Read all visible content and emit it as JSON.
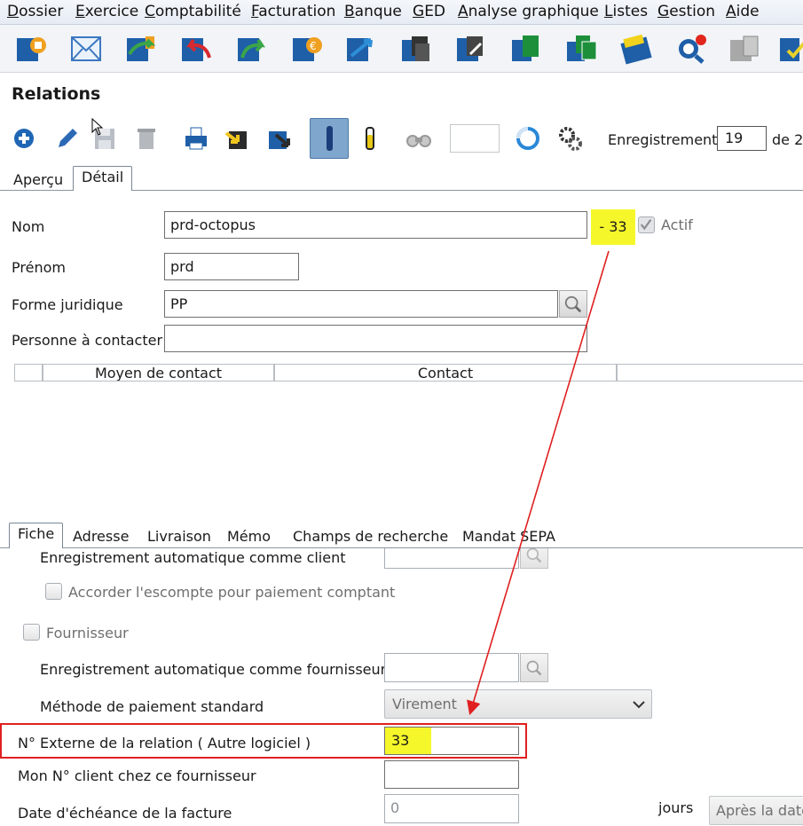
{
  "menu": [
    "Dossier",
    "Exercice",
    "Comptabilité",
    "Facturation",
    "Banque",
    "GED",
    "Analyse graphique",
    "Listes",
    "Gestion",
    "Aide"
  ],
  "toolbar_icons": [
    "dossier-icon",
    "mail-icon",
    "import-icon",
    "undo-icon",
    "redo-icon",
    "euro-icon",
    "transfer-icon",
    "copy-icon",
    "attach-icon",
    "document-green-icon",
    "documents-green-icon",
    "calendar-icon",
    "alert-search-icon",
    "grey-tools-icon",
    "check-icon"
  ],
  "page_title": "Relations",
  "record_nav": {
    "label": "Enregistrement",
    "current": "19",
    "of_label": "de 2"
  },
  "main_tabs": [
    "Aperçu",
    "Détail"
  ],
  "form": {
    "nom_label": "Nom",
    "nom_value": "prd-octopus",
    "nom_id_highlight": "- 33",
    "actif_label": "Actif",
    "prenom_label": "Prénom",
    "prenom_value": "prd",
    "forme_label": "Forme juridique",
    "forme_value": "PP",
    "contact_person_label": "Personne à contacter",
    "contact_person_value": ""
  },
  "contact_grid": {
    "headers": [
      "Moyen de contact",
      "Contact"
    ]
  },
  "sub_tabs": [
    "Fiche",
    "Adresse",
    "Livraison",
    "Mémo",
    "Champs de recherche",
    "Mandat SEPA"
  ],
  "fiche": {
    "auto_client_label": "Enregistrement automatique comme client",
    "escompte_label": "Accorder l'escompte pour paiement comptant",
    "fournisseur_label": "Fournisseur",
    "auto_fournisseur_label": "Enregistrement automatique comme fournisseur",
    "methode_label": "Méthode de paiement standard",
    "methode_value": "Virement",
    "num_externe_label": "N° Externe de la relation ( Autre logiciel )",
    "num_externe_value": "33",
    "mon_num_label": "Mon N° client chez ce fournisseur",
    "echeance_label": "Date d'échéance de la facture",
    "echeance_value": "0",
    "jours_label": "jours",
    "apres_label": "Après la date"
  },
  "colors": {
    "highlight": "#f6f72a",
    "annotation_red": "#e02020",
    "pressed": "#7fa6cc"
  }
}
